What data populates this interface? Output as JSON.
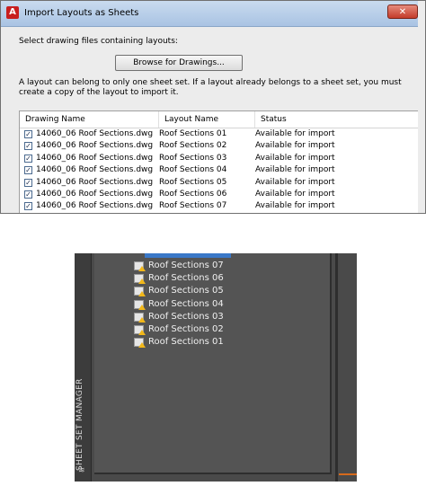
{
  "dialog": {
    "title": "Import Layouts as Sheets",
    "close_glyph": "✕",
    "instruction": "Select drawing files containing layouts:",
    "browse_label": "Browse for Drawings...",
    "note": "A layout can belong to only one sheet set. If a layout already belongs to a sheet set, you must create a copy of the layout to import it.",
    "columns": [
      "Drawing Name",
      "Layout Name",
      "Status"
    ],
    "rows": [
      {
        "drawing": "14060_06 Roof Sections.dwg",
        "layout": "Roof Sections 01",
        "status": "Available for import",
        "checked": true
      },
      {
        "drawing": "14060_06 Roof Sections.dwg",
        "layout": "Roof Sections 02",
        "status": "Available for import",
        "checked": true
      },
      {
        "drawing": "14060_06 Roof Sections.dwg",
        "layout": "Roof Sections 03",
        "status": "Available for import",
        "checked": true
      },
      {
        "drawing": "14060_06 Roof Sections.dwg",
        "layout": "Roof Sections 04",
        "status": "Available for import",
        "checked": true
      },
      {
        "drawing": "14060_06 Roof Sections.dwg",
        "layout": "Roof Sections 05",
        "status": "Available for import",
        "checked": true
      },
      {
        "drawing": "14060_06 Roof Sections.dwg",
        "layout": "Roof Sections 06",
        "status": "Available for import",
        "checked": true
      },
      {
        "drawing": "14060_06 Roof Sections.dwg",
        "layout": "Roof Sections 07",
        "status": "Available for import",
        "checked": true
      }
    ]
  },
  "sheet_set_manager": {
    "panel_label": "SHEET SET MANAGER",
    "sheets": [
      "Roof Sections 07",
      "Roof Sections 06",
      "Roof Sections 05",
      "Roof Sections 04",
      "Roof Sections 03",
      "Roof Sections 02",
      "Roof Sections 01"
    ]
  },
  "colors": {
    "selection": "#3a78c8",
    "warning": "#f2b81a",
    "panel_bg": "#4a4a4a"
  }
}
